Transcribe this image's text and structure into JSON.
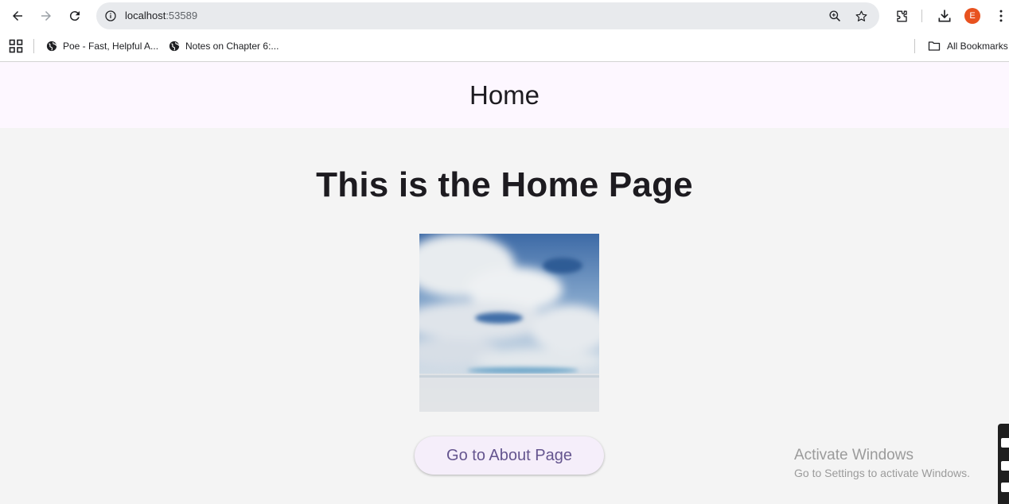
{
  "browser": {
    "url_host": "localhost",
    "url_port": ":53589",
    "profile_initial": "E",
    "bookmarks": [
      {
        "label": "Poe - Fast, Helpful A..."
      },
      {
        "label": "Notes on Chapter 6:..."
      }
    ],
    "all_bookmarks_label": "All Bookmarks",
    "icons": [
      "back-icon",
      "forward-icon",
      "reload-icon",
      "site-info-icon",
      "zoom-icon",
      "star-icon",
      "extensions-icon",
      "download-icon",
      "more-icon",
      "apps-icon",
      "globe-icon",
      "folder-icon"
    ]
  },
  "app": {
    "appbar_title": "Home",
    "heading": "This is the Home Page",
    "button_label": "Go to About Page"
  },
  "watermark": {
    "title": "Activate Windows",
    "subtitle": "Go to Settings to activate Windows."
  },
  "colors": {
    "appbar_bg": "#fdf7ff",
    "body_bg": "#f4f4f4",
    "button_bg": "#f5eefa",
    "button_text": "#65558f",
    "avatar_bg": "#e8521f"
  }
}
